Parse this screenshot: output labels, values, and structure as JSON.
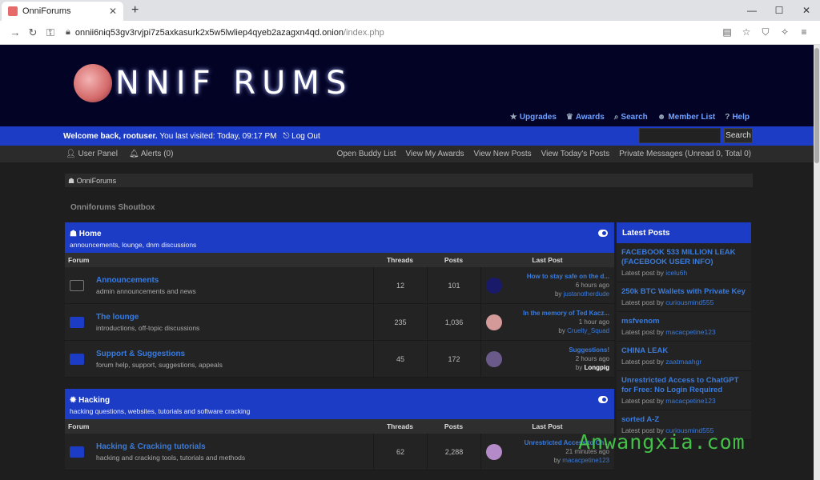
{
  "browser": {
    "tab_title": "OnniForums",
    "url_host": "onnii6niq53gv3rvjpi7z5axkasurk2x5w5lwliep4qyeb2azagxn4qd.onion",
    "url_path": "/index.php"
  },
  "header": {
    "logo_text": "NNIF  RUMS",
    "nav": [
      "Upgrades",
      "Awards",
      "Search",
      "Member List",
      "Help"
    ]
  },
  "welcome": {
    "greeting": "Welcome back, rootuser.",
    "last_visit": "You last visited: Today, 09:17 PM",
    "logout": "Log Out",
    "search_button": "Search"
  },
  "userbar": {
    "user_panel": "User Panel",
    "alerts": "Alerts (0)",
    "links": [
      "Open Buddy List",
      "View My Awards",
      "View New Posts",
      "View Today's Posts",
      "Private Messages (Unread 0, Total 0)"
    ]
  },
  "breadcrumb": "OnniForums",
  "shoutbox_title": "Onniforums Shoutbox",
  "columns": {
    "forum": "Forum",
    "threads": "Threads",
    "posts": "Posts",
    "last_post": "Last Post"
  },
  "categories": [
    {
      "title": "Home",
      "desc": "announcements, lounge, dnm discussions",
      "forums": [
        {
          "name": "Announcements",
          "desc": "admin announcements and news",
          "threads": "12",
          "posts": "101",
          "lp_title": "How to stay safe on the d...",
          "lp_time": "6 hours ago",
          "lp_user": "justanotherdude",
          "avatar_color": "#1a1a6a",
          "icon": "off"
        },
        {
          "name": "The lounge",
          "desc": "introductions, off-topic discussions",
          "threads": "235",
          "posts": "1,036",
          "lp_title": "In the memory of Ted Kacz...",
          "lp_time": "1 hour ago",
          "lp_user": "Cruelty_Squad",
          "avatar_color": "#d49a9a",
          "icon": "on"
        },
        {
          "name": "Support & Suggestions",
          "desc": "forum help, support, suggestions, appeals",
          "threads": "45",
          "posts": "172",
          "lp_title": "Suggestions!",
          "lp_time": "2 hours ago",
          "lp_user": "Longpig",
          "avatar_color": "#6a5a8a",
          "icon": "on"
        }
      ]
    },
    {
      "title": "Hacking",
      "desc": "hacking questions, websites, tutorials and software cracking",
      "forums": [
        {
          "name": "Hacking & Cracking tutorials",
          "desc": "hacking and cracking tools, tutorials and methods",
          "threads": "62",
          "posts": "2,288",
          "lp_title": "Unrestricted Access to Ch...",
          "lp_time": "21 minutes ago",
          "lp_user": "macacpetine123",
          "avatar_color": "#b48ac8",
          "icon": "on"
        }
      ]
    }
  ],
  "latest_posts": {
    "title": "Latest Posts",
    "items": [
      {
        "title": "FACEBOOK 533 MILLION LEAK (FACEBOOK USER INFO)",
        "user": "icelu6h"
      },
      {
        "title": "250k BTC Wallets with Private Key",
        "user": "curiousmind555"
      },
      {
        "title": "msfvenom",
        "user": "macacpetine123"
      },
      {
        "title": "CHINA LEAK",
        "user": "zaatmaahgr"
      },
      {
        "title": "Unrestricted Access to ChatGPT for Free: No Login Required",
        "user": "macacpetine123"
      },
      {
        "title": "sorted A-Z",
        "user": "curiousmind555"
      }
    ],
    "meta_label": "Latest post by"
  },
  "watermark": "Anwangxia.com"
}
